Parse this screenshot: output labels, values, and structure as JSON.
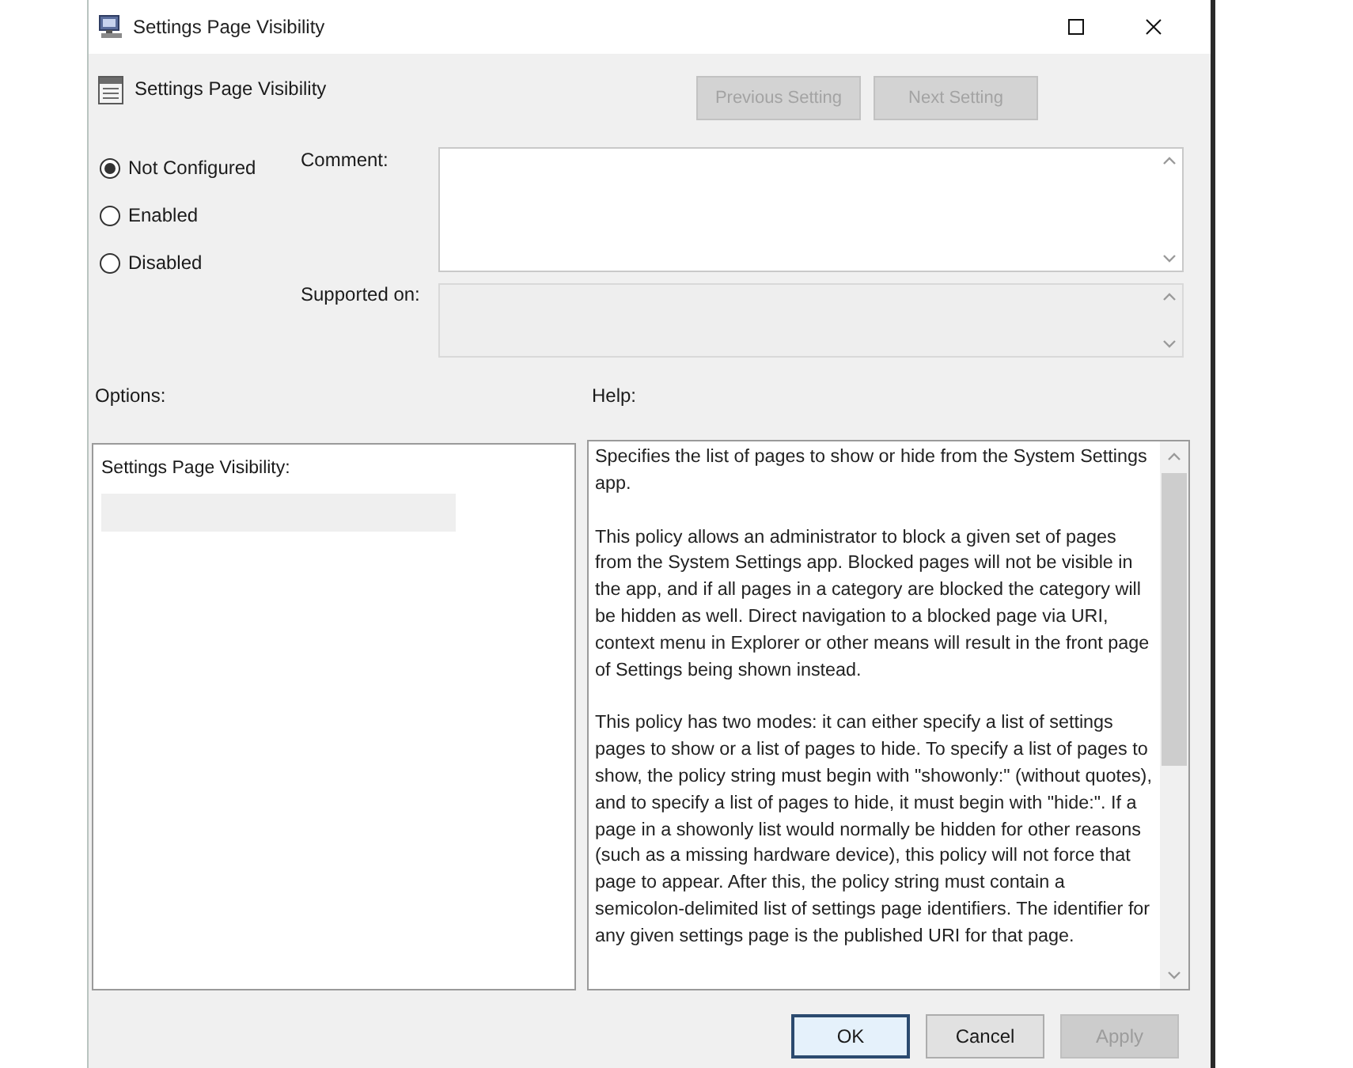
{
  "window": {
    "title": "Settings Page Visibility"
  },
  "header": {
    "title": "Settings Page Visibility",
    "buttons": [
      {
        "label": "Previous Setting",
        "disabled": true
      },
      {
        "label": "Next Setting",
        "disabled": true
      }
    ]
  },
  "state_options": [
    {
      "label": "Not Configured",
      "selected": true
    },
    {
      "label": "Enabled",
      "selected": false
    },
    {
      "label": "Disabled",
      "selected": false
    }
  ],
  "comment": {
    "label": "Comment:"
  },
  "supported_on": {
    "label": "Supported on:",
    "disabled": true
  },
  "options": {
    "label": "Options:",
    "field_label": "Settings Page Visibility:",
    "field_disabled": true
  },
  "help": {
    "label": "Help:",
    "paragraphs": [
      "Specifies the list of pages to show or hide from the System Settings app.",
      "This policy allows an administrator to block a given set of pages from the System Settings app. Blocked pages will not be visible in the app, and if all pages in a category are blocked the category will be hidden as well. Direct navigation to a blocked page via URI, context menu in Explorer or other means will result in the front page of Settings being shown instead.",
      "This policy has two modes: it can either specify a list of settings pages to show or a list of pages to hide. To specify a list of pages to show, the policy string must begin with \"showonly:\" (without quotes), and to specify a list of pages to hide, it must begin with \"hide:\". If a page in a showonly list would normally be hidden for other reasons (such as a missing hardware device), this policy will not force that page to appear. After this, the policy string must contain a semicolon-delimited list of settings page identifiers. The identifier for any given settings page is the published URI for that page."
    ]
  },
  "footer_buttons": [
    {
      "label": "OK",
      "default": true,
      "disabled": false
    },
    {
      "label": "Cancel",
      "default": false,
      "disabled": false
    },
    {
      "label": "Apply",
      "default": false,
      "disabled": true
    }
  ]
}
